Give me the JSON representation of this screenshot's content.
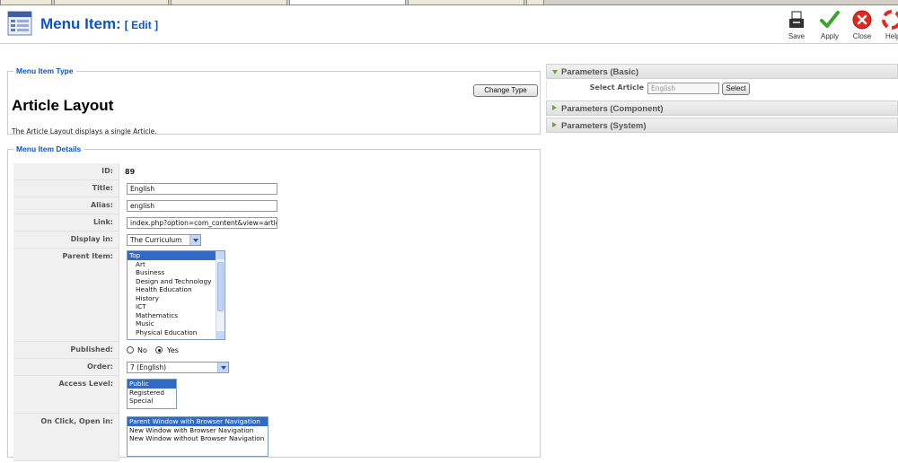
{
  "header": {
    "title": "Menu Item:",
    "subtitle": "[ Edit ]",
    "toolbar": [
      {
        "label": "Save",
        "icon": "save-icon"
      },
      {
        "label": "Apply",
        "icon": "apply-check-icon"
      },
      {
        "label": "Close",
        "icon": "close-icon"
      },
      {
        "label": "Help",
        "icon": "help-lifebuoy-icon"
      }
    ]
  },
  "menu_item_type": {
    "legend": "Menu Item Type",
    "heading": "Article Layout",
    "description": "The Article Layout displays a single Article.",
    "change_button": "Change Type"
  },
  "details": {
    "legend": "Menu Item Details",
    "id_label": "ID:",
    "id_value": "89",
    "title_label": "Title:",
    "title_value": "English",
    "alias_label": "Alias:",
    "alias_value": "english",
    "link_label": "Link:",
    "link_value": "index.php?option=com_content&view=article&i",
    "display_label": "Display in:",
    "display_value": "The Curriculum",
    "parent_label": "Parent Item:",
    "parent_options": [
      "Top",
      "Art",
      "Business",
      "Design and Technology",
      "Health Education",
      "History",
      "ICT",
      "Mathematics",
      "Music",
      "Physical Education"
    ],
    "published_label": "Published:",
    "published_no": "No",
    "published_yes": "Yes",
    "published_value": "Yes",
    "order_label": "Order:",
    "order_value": "7 (English)",
    "access_label": "Access Level:",
    "access_options": [
      "Public",
      "Registered",
      "Special"
    ],
    "onclick_label": "On Click, Open in:",
    "onclick_options": [
      "Parent Window with Browser Navigation",
      "New Window with Browser Navigation",
      "New Window without Browser Navigation"
    ]
  },
  "parameters": {
    "basic": "Parameters (Basic)",
    "select_article_label": "Select Article",
    "select_article_value": "English",
    "select_button": "Select",
    "component": "Parameters (Component)",
    "system": "Parameters (System)"
  },
  "colors": {
    "accent": "#0b55c4",
    "selection": "#316ac5",
    "param_arrow": "#6fa43c"
  }
}
